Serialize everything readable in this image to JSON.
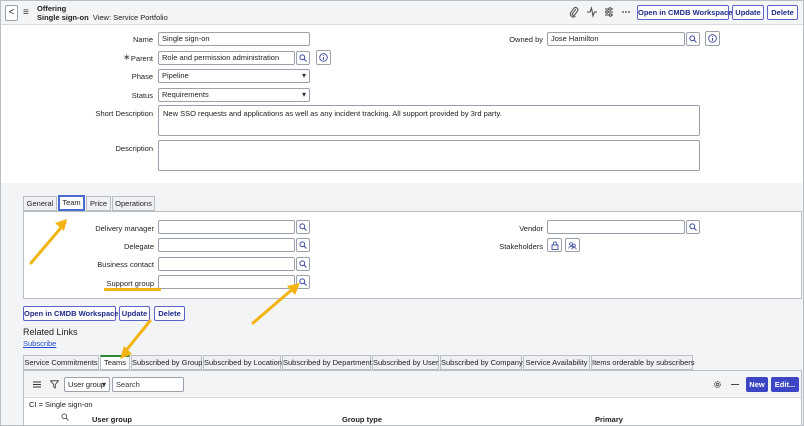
{
  "header": {
    "back": "<",
    "menu": "≡",
    "record_type": "Offering",
    "record_name": "Single sign-on",
    "view_label": "View: Service Portfolio",
    "icons": [
      "paperclip-icon",
      "activity-icon",
      "settings-sliders-icon",
      "more-icon"
    ],
    "btn_open_cmdb": "Open in CMDB Workspace",
    "btn_update": "Update",
    "btn_delete": "Delete"
  },
  "form": {
    "name_label": "Name",
    "name_value": "Single sign-on",
    "parent_label": "Parent",
    "parent_value": "Role and permission administration",
    "phase_label": "Phase",
    "phase_value": "Pipeline",
    "status_label": "Status",
    "status_value": "Requirements",
    "short_desc_label": "Short Description",
    "short_desc_value": "New SSO requests and applications as well as any incident tracking. All support provided by 3rd party.",
    "desc_label": "Description",
    "desc_value": "",
    "owned_by_label": "Owned by",
    "owned_by_value": "Jose Hamilton",
    "required_mark": "∗"
  },
  "tabs": [
    "General",
    "Team",
    "Price",
    "Operations"
  ],
  "team": {
    "delivery_manager_label": "Delivery manager",
    "delegate_label": "Delegate",
    "business_contact_label": "Business contact",
    "support_group_label": "Support group",
    "vendor_label": "Vendor",
    "stakeholders_label": "Stakeholders"
  },
  "bottom_buttons": {
    "open_cmdb": "Open in CMDB Workspace",
    "update": "Update",
    "delete": "Delete"
  },
  "related": {
    "title": "Related Links",
    "subscribe": "Subscribe",
    "tabs": [
      "Service Commitments",
      "Teams",
      "Subscribed by Group",
      "Subscribed by Location",
      "Subscribed by Department",
      "Subscribed by User",
      "Subscribed by Company",
      "Service Availability",
      "Items orderable by subscribers"
    ]
  },
  "list": {
    "filter_field": "User group",
    "search_placeholder": "Search",
    "btn_new": "New",
    "btn_edit": "Edit...",
    "breadcrumb": "CI = Single sign-on",
    "columns": [
      "User group",
      "Group type",
      "Primary"
    ]
  },
  "colors": {
    "accent": "#3c46c4",
    "arrow": "#f2b413",
    "active_tab": "#4a6ad1",
    "teams_tab_indicator": "#2a8a3a"
  }
}
